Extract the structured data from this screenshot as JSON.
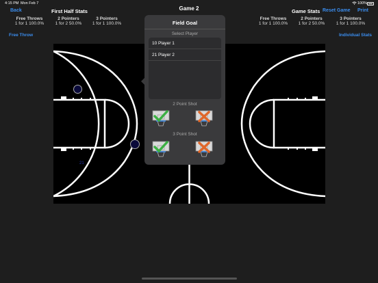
{
  "status": {
    "time": "4:15 PM",
    "date": "Mon Feb 7",
    "battery": "100%"
  },
  "nav": {
    "back": "Back",
    "title": "Game 2",
    "reset": "Reset Game",
    "print": "Print"
  },
  "first_half": {
    "heading": "First Half Stats",
    "cols": [
      {
        "label": "Free Throws",
        "value": "1 for 1  100.0%"
      },
      {
        "label": "2 Pointers",
        "value": "1 for 2  50.0%"
      },
      {
        "label": "3 Pointers",
        "value": "1 for 1  100.0%"
      }
    ]
  },
  "game_stats": {
    "heading": "Game Stats",
    "cols": [
      {
        "label": "Free Throws",
        "value": "1 for 1  100.0%"
      },
      {
        "label": "2 Pointers",
        "value": "1 for 2  50.0%"
      },
      {
        "label": "3 Pointers",
        "value": "1 for 1  100.0%"
      }
    ]
  },
  "links": {
    "free_throw": "Free Throw",
    "individual_stats": "Individual Stats"
  },
  "popover": {
    "title": "Field Goal",
    "select_player": "Select Player",
    "players": [
      "10 Player 1",
      "21 Player 2"
    ],
    "two_point": "2 Point Shot",
    "three_point": "3 Point Shot"
  },
  "court": {
    "marker_number": "21"
  },
  "colors": {
    "accent": "#3b8ef0",
    "made": "#3cb043",
    "missed": "#e0672a"
  }
}
